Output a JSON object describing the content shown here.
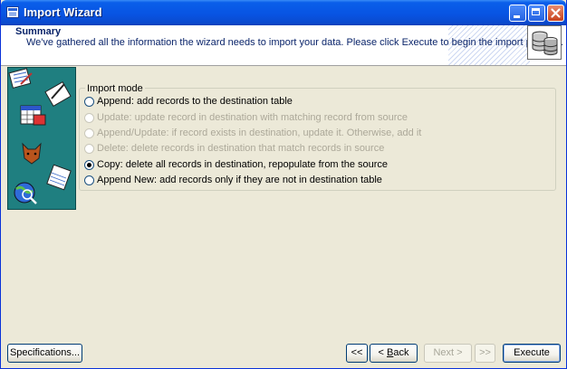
{
  "window": {
    "title": "Import Wizard"
  },
  "header": {
    "title": "Summary",
    "description": "We've gathered all the information the wizard needs to import your data. Please click Execute to begin the import process."
  },
  "import_mode": {
    "legend": "Import mode",
    "options": [
      {
        "label": "Append: add records to the destination table",
        "enabled": true,
        "selected": false
      },
      {
        "label": "Update: update record in destination with matching record from source",
        "enabled": false,
        "selected": false
      },
      {
        "label": "Append/Update: if record exists in destination, update it. Otherwise, add it",
        "enabled": false,
        "selected": false
      },
      {
        "label": "Delete: delete records in destination that match records in source",
        "enabled": false,
        "selected": false
      },
      {
        "label": "Copy: delete all records in destination, repopulate from the source",
        "enabled": true,
        "selected": true
      },
      {
        "label": "Append New: add records only if they are not in destination table",
        "enabled": true,
        "selected": false
      }
    ]
  },
  "buttons": {
    "specifications": "Specifications...",
    "first": "<<",
    "back_prefix": "< ",
    "back_accel": "B",
    "back_rest": "ack",
    "next": "Next >",
    "last": ">>",
    "execute": "Execute"
  },
  "colors": {
    "titlebar": "#0854E3",
    "panel_teal": "#1F7F80",
    "dialog_bg": "#ECE9D8",
    "header_text": "#0A246A"
  }
}
